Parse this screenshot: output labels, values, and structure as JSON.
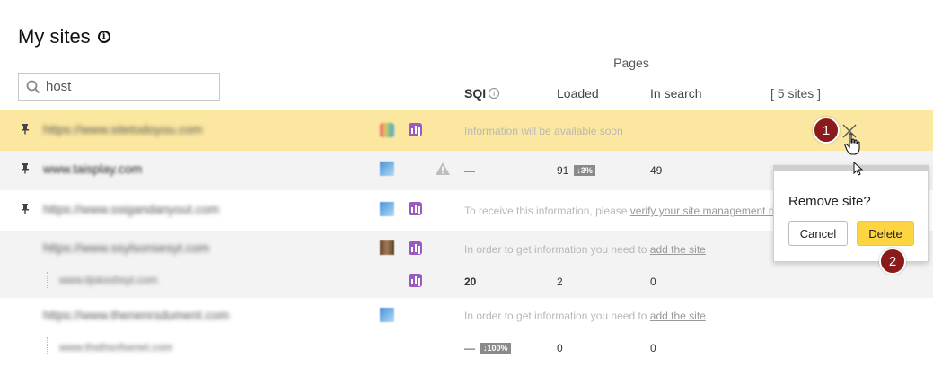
{
  "page": {
    "title": "My sites",
    "info_icon": "info-icon"
  },
  "search": {
    "value": "host",
    "icon": "search-icon"
  },
  "table_header": {
    "pages_group": "Pages",
    "sqi": "SQI",
    "loaded": "Loaded",
    "in_search": "In search",
    "site_count": "[ 5 sites ]"
  },
  "rows": [
    {
      "host": "https://www.sitetodoyou.com",
      "message": "Information will be available soon",
      "highlighted": true
    },
    {
      "host": "www.taisplay.com",
      "sqi": "—",
      "loaded": "91",
      "loaded_badge": "↓3%",
      "in_search": "49"
    },
    {
      "host": "https://www.ssigandanyout.com",
      "message_prefix": "To receive this information, please ",
      "message_link": "verify your site management rights"
    },
    {
      "host": "https://www.ssylsonsesyt.com",
      "message_prefix": "In order to get information you need to ",
      "message_link": "add the site",
      "child": {
        "host": "www.tijsksshsyt.com",
        "sqi": "20",
        "loaded": "2",
        "in_search": "0"
      }
    },
    {
      "host": "https://www.thenenrsdument.com",
      "message_prefix": "In order to get information you need to ",
      "message_link": "add the site",
      "child": {
        "host": "www.thsthsnfsenet.com",
        "sqi": "—",
        "sqi_badge": "↓100%",
        "loaded": "0",
        "in_search": "0"
      }
    }
  ],
  "popup": {
    "title": "Remove site?",
    "cancel": "Cancel",
    "delete": "Delete"
  },
  "markers": {
    "one": "1",
    "two": "2"
  },
  "colors": {
    "highlight_row": "#fbe79f",
    "delete_button": "#fcd540",
    "marker": "#8b1a1a",
    "metrica": "#9b59c6"
  }
}
